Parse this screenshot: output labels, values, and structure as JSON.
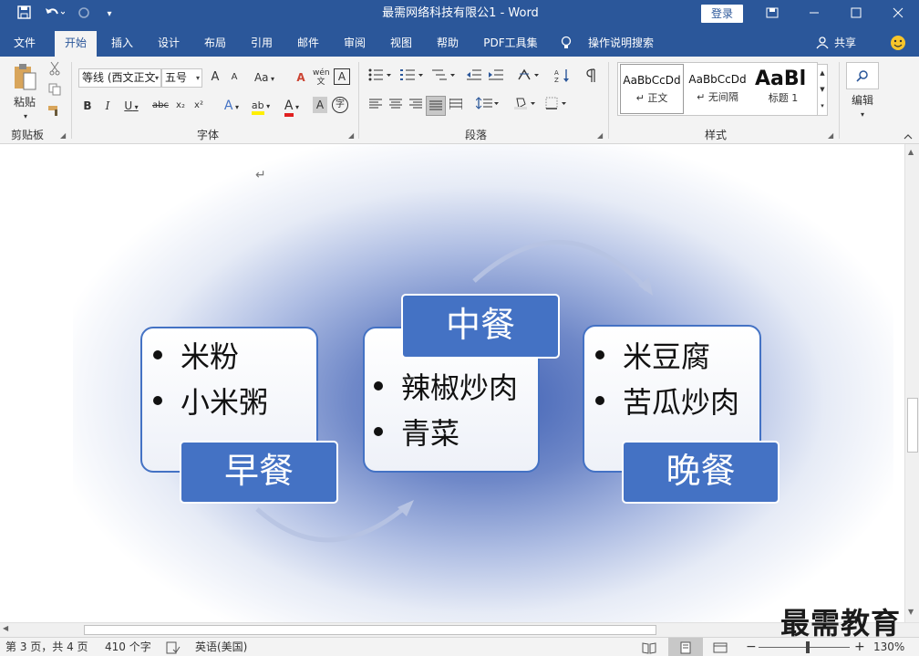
{
  "titlebar": {
    "title": "最需网络科技有限公1 - Word",
    "login_label": "登录",
    "icons": {
      "save": "save-icon",
      "undo": "undo-icon",
      "redo": "redo-icon",
      "customize": "customize-qat-icon",
      "ribbon_display": "ribbon-display-icon",
      "minimize": "minimize-icon",
      "maximize": "maximize-icon",
      "close": "close-icon"
    }
  },
  "tabs": {
    "file": "文件",
    "home": "开始",
    "insert": "插入",
    "design": "设计",
    "layout": "布局",
    "references": "引用",
    "mailings": "邮件",
    "review": "审阅",
    "view": "视图",
    "help": "帮助",
    "pdf": "PDF工具集",
    "tellme": "操作说明搜索",
    "share": "共享"
  },
  "ribbon": {
    "clipboard": {
      "label": "剪贴板",
      "paste": "粘贴"
    },
    "font": {
      "label": "字体",
      "font_name": "等线 (西文正文)",
      "font_size": "五号",
      "grow": "A",
      "shrink": "A",
      "case": "Aa",
      "clear": "A",
      "phonetic": "wén",
      "charborder": "A",
      "bold": "B",
      "italic": "I",
      "underline": "U",
      "strike": "abc",
      "sub": "x₂",
      "sup": "x²",
      "effects": "A",
      "highlight": "ab",
      "color": "A",
      "shade": "A",
      "enclose": "字"
    },
    "paragraph": {
      "label": "段落"
    },
    "styles": {
      "label": "样式",
      "items": [
        {
          "preview": "AaBbCcDd",
          "name": "↵ 正文"
        },
        {
          "preview": "AaBbCcDd",
          "name": "↵ 无间隔"
        },
        {
          "preview": "AaBl",
          "name": "标题 1"
        }
      ]
    },
    "editing": {
      "label": "编辑"
    }
  },
  "document": {
    "paragraph_mark": "↵",
    "smartart": {
      "cards": [
        {
          "title": "早餐",
          "items": [
            "米粉",
            "小米粥"
          ]
        },
        {
          "title": "中餐",
          "items": [
            "辣椒炒肉",
            "青菜"
          ]
        },
        {
          "title": "晚餐",
          "items": [
            "米豆腐",
            "苦瓜炒肉"
          ]
        }
      ]
    }
  },
  "statusbar": {
    "page": "第 3 页，共 4 页",
    "words": "410 个字",
    "language": "英语(美国)",
    "zoom": "130%",
    "zoom_minus": "−",
    "zoom_plus": "+"
  },
  "watermark": "最需教育",
  "colors": {
    "brand": "#2b579a",
    "accent": "#4472c4"
  }
}
